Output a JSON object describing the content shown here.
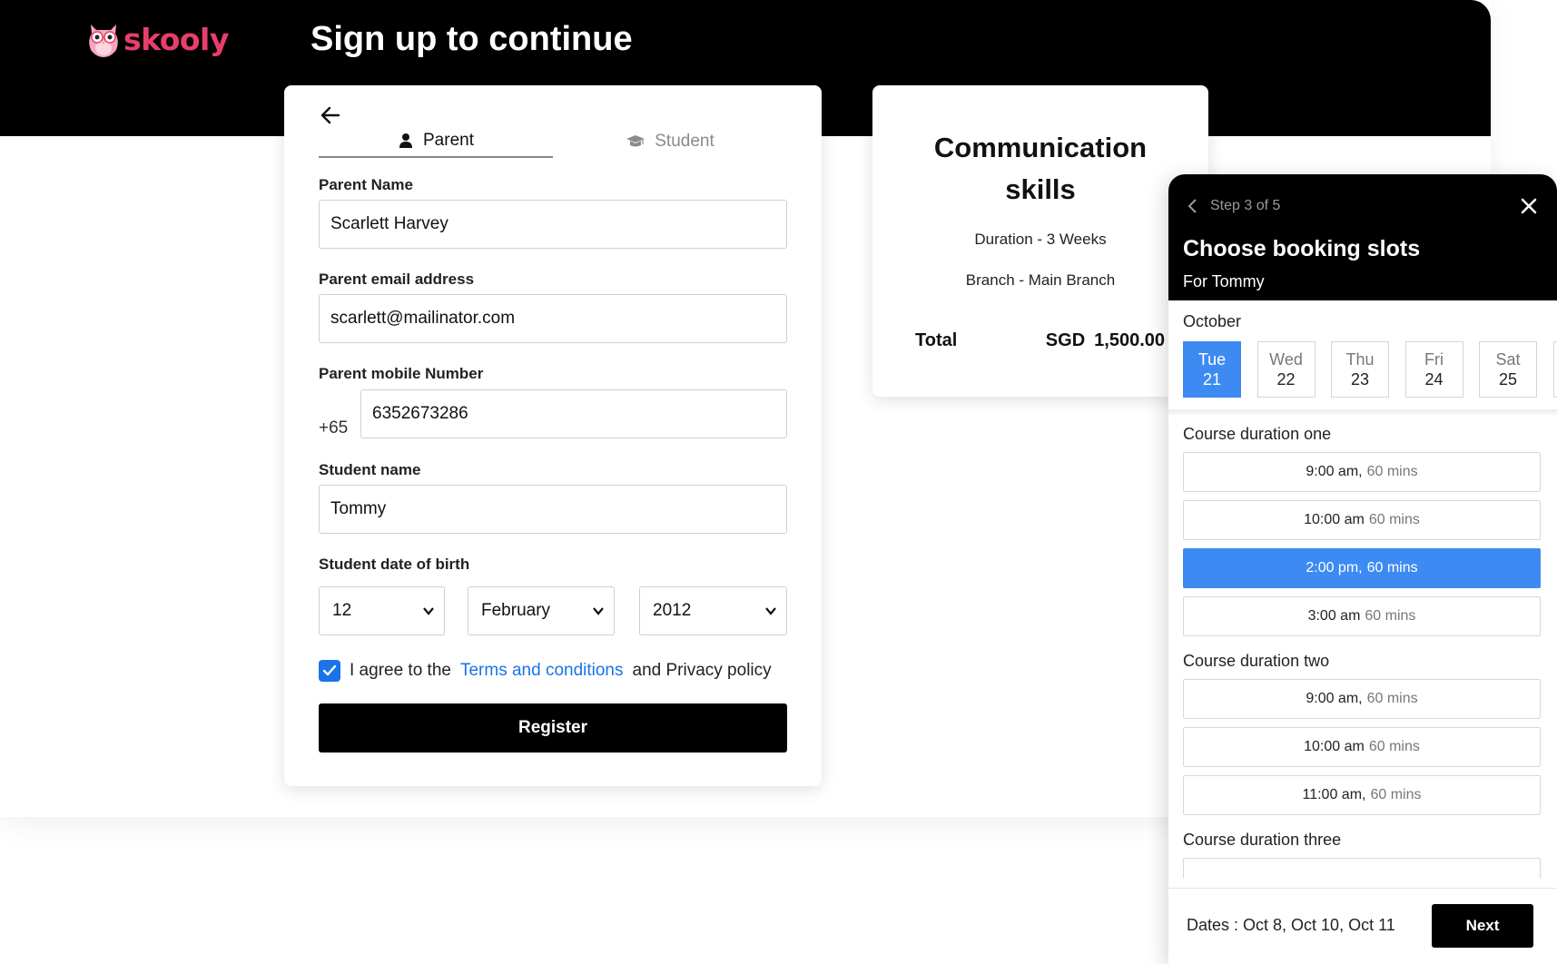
{
  "brand": {
    "logo_text": "skooly",
    "logo_color": "#e83e6b"
  },
  "header": {
    "title": "Sign up to continue"
  },
  "form": {
    "tabs": [
      {
        "label": "Parent",
        "icon": "user-icon",
        "active": true
      },
      {
        "label": "Student",
        "icon": "graduation-cap-icon",
        "active": false
      }
    ],
    "parent_name": {
      "label": "Parent Name",
      "value": "Scarlett Harvey"
    },
    "parent_email": {
      "label": "Parent email address",
      "value": "scarlett@mailinator.com"
    },
    "parent_mobile": {
      "label": "Parent mobile Number",
      "prefix": "+65",
      "value": "6352673286"
    },
    "student_name": {
      "label": "Student name",
      "value": "Tommy"
    },
    "dob": {
      "label": "Student date of birth",
      "day": "12",
      "month": "February",
      "year": "2012"
    },
    "agree": {
      "checked": true,
      "prefix": "I agree to the",
      "terms_link": "Terms and conditions",
      "suffix": "and Privacy policy"
    },
    "register_label": "Register"
  },
  "course": {
    "title_line1": "Communication",
    "title_line2": "skills",
    "duration": "Duration - 3 Weeks",
    "branch": "Branch - Main Branch",
    "total_label": "Total",
    "currency": "SGD",
    "amount": "1,500.00"
  },
  "booking": {
    "step": "Step 3 of 5",
    "title": "Choose booking slots",
    "for": "For Tommy",
    "month": "October",
    "days": [
      {
        "name": "Tue",
        "num": "21",
        "selected": true
      },
      {
        "name": "Wed",
        "num": "22",
        "selected": false
      },
      {
        "name": "Thu",
        "num": "23",
        "selected": false
      },
      {
        "name": "Fri",
        "num": "24",
        "selected": false
      },
      {
        "name": "Sat",
        "num": "25",
        "selected": false
      }
    ],
    "groups": [
      {
        "label": "Course duration one",
        "slots": [
          {
            "time": "9:00 am,",
            "duration": "60 mins",
            "selected": false
          },
          {
            "time": "10:00 am",
            "duration": "60 mins",
            "selected": false
          },
          {
            "time": "2:00 pm,",
            "duration": "60 mins",
            "selected": true
          },
          {
            "time": "3:00 am",
            "duration": "60 mins",
            "selected": false
          }
        ]
      },
      {
        "label": "Course duration two",
        "slots": [
          {
            "time": "9:00 am,",
            "duration": "60 mins",
            "selected": false
          },
          {
            "time": "10:00 am",
            "duration": "60 mins",
            "selected": false
          },
          {
            "time": "11:00 am,",
            "duration": "60 mins",
            "selected": false
          }
        ]
      },
      {
        "label": "Course duration three",
        "slots": [
          {
            "time": "",
            "duration": "",
            "selected": false
          }
        ]
      }
    ],
    "footer_dates": "Dates : Oct 8, Oct 10, Oct 11",
    "next_label": "Next",
    "accent_color": "#3d8bf2"
  }
}
